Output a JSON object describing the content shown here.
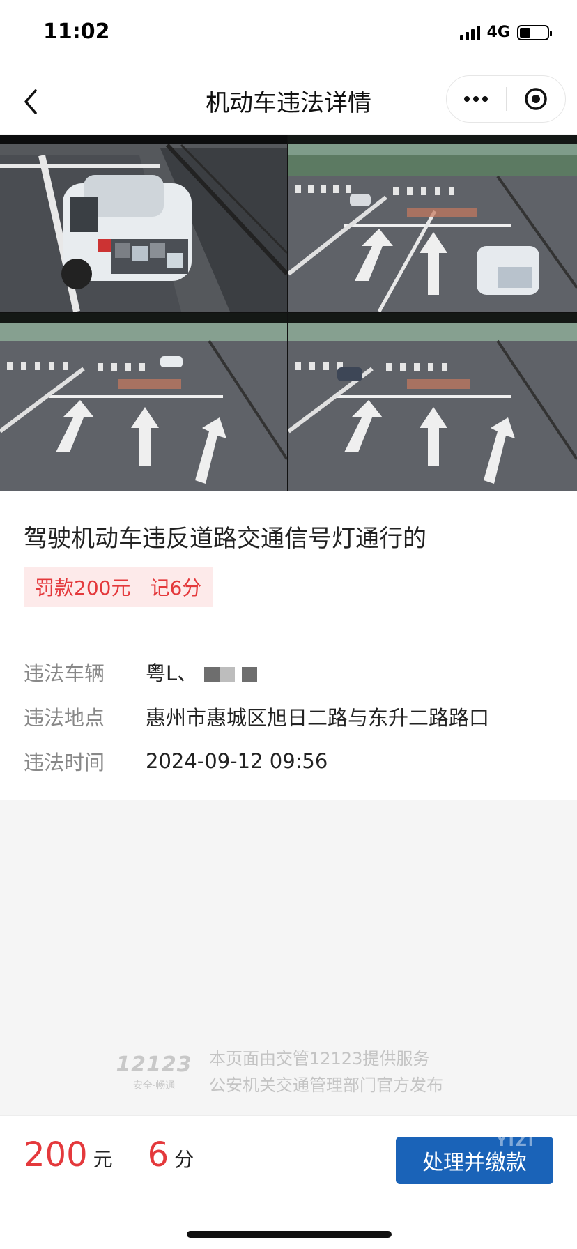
{
  "status_bar": {
    "time": "11:02",
    "network": "4G"
  },
  "nav": {
    "title": "机动车违法详情"
  },
  "violation": {
    "title": "驾驶机动车违反道路交通信号灯通行的",
    "fine": "罚款200元",
    "points": "记6分",
    "rows": [
      {
        "label": "违法车辆",
        "value": "粤L、"
      },
      {
        "label": "违法地点",
        "value": "惠州市惠城区旭日二路与东升二路路口"
      },
      {
        "label": "违法时间",
        "value": "2024-09-12 09:56"
      }
    ]
  },
  "footer": {
    "brand_number": "12123",
    "brand_slogan": "安全·畅通",
    "line1": "本页面由交管12123提供服务",
    "line2": "公安机关交通管理部门官方发布"
  },
  "bottom": {
    "amount": "200",
    "amount_unit": "元",
    "points": "6",
    "points_unit": "分",
    "button_label": "处理并缴款",
    "watermark": "YIZI"
  },
  "colors": {
    "accent_red": "#e4393c",
    "button_blue": "#1a63b8"
  }
}
